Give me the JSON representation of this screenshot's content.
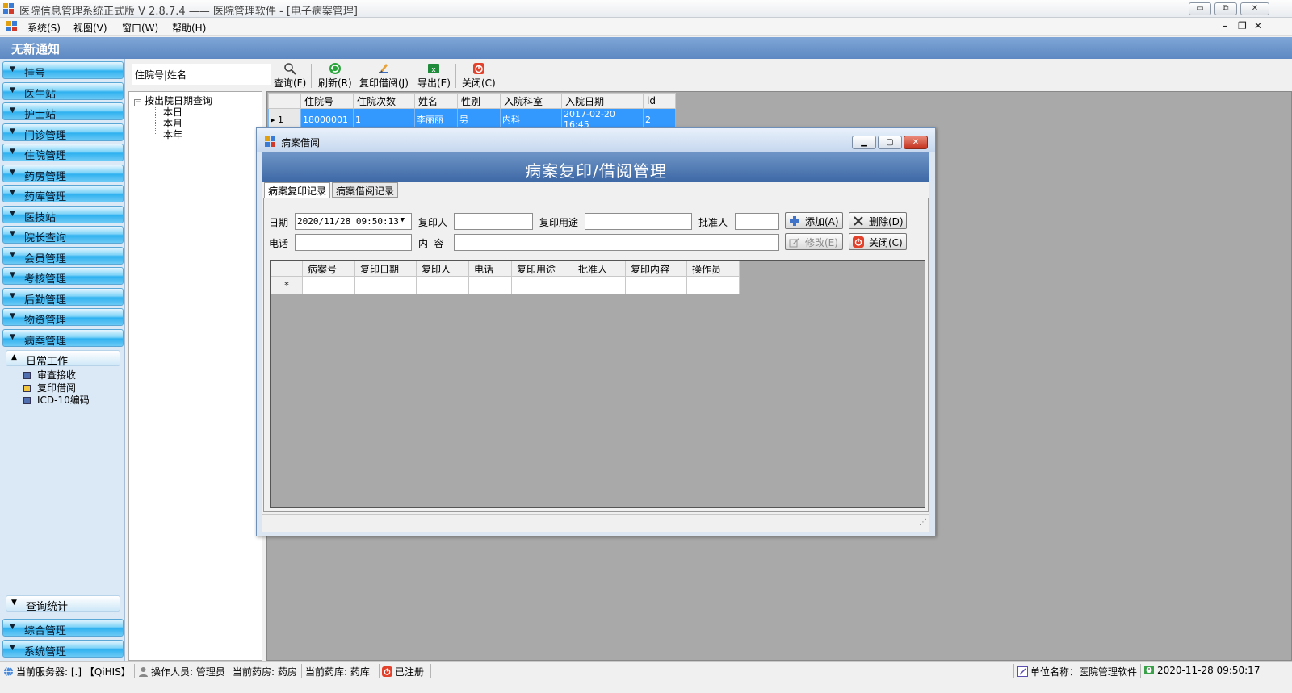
{
  "window": {
    "title": "医院信息管理系统正式版 V 2.8.7.4 —— 医院管理软件 - [电子病案管理]",
    "min": "▭",
    "restore": "⧉",
    "close": "✕"
  },
  "menu": {
    "items": [
      "系统(S)",
      "视图(V)",
      "窗口(W)",
      "帮助(H)"
    ],
    "mdi_controls": [
      "–",
      "❐",
      "✕"
    ]
  },
  "notice": "无新通知",
  "sidebar": {
    "items": [
      "挂号",
      "医生站",
      "护士站",
      "门诊管理",
      "住院管理",
      "药房管理",
      "药库管理",
      "医技站",
      "院长查询",
      "会员管理",
      "考核管理",
      "后勤管理",
      "物资管理",
      "病案管理"
    ],
    "bottom_items": [
      "综合管理",
      "系统管理"
    ],
    "groups": {
      "daily": "日常工作",
      "query": "查询统计"
    },
    "daily_items": [
      "审查接收",
      "复印借阅",
      "ICD-10编码"
    ]
  },
  "toolbar": {
    "search_value": "住院号|姓名",
    "buttons": [
      "查询(F)",
      "刷新(R)",
      "复印借阅(J)",
      "导出(E)",
      "关闭(C)"
    ]
  },
  "date_tree": {
    "root": "按出院日期查询",
    "children": [
      "本日",
      "本月",
      "本年"
    ]
  },
  "patient_grid": {
    "headers": [
      "住院号",
      "住院次数",
      "姓名",
      "性别",
      "入院科室",
      "入院日期",
      "id"
    ],
    "rows": [
      {
        "rownum": "1",
        "cells": [
          "18000001",
          "1",
          "李丽丽",
          "男",
          "内科",
          "2017-02-20 16:45",
          "2"
        ]
      }
    ]
  },
  "dialog": {
    "title": "病案借阅",
    "banner": "病案复印/借阅管理",
    "tabs": [
      "病案复印记录",
      "病案借阅记录"
    ],
    "form": {
      "date_label": "日期",
      "date_value": "2020/11/28 09:50:13",
      "copier_label": "复印人",
      "purpose_label": "复印用途",
      "approver_label": "批准人",
      "phone_label": "电话",
      "content_label": "内  容"
    },
    "buttons": {
      "add": "添加(A)",
      "delete": "删除(D)",
      "edit": "修改(E)",
      "close": "关闭(C)"
    },
    "grid": {
      "headers": [
        "病案号",
        "复印日期",
        "复印人",
        "电话",
        "复印用途",
        "批准人",
        "复印内容",
        "操作员"
      ],
      "new_row_marker": "*"
    }
  },
  "statusbar": {
    "server": "当前服务器: [.] 【QiHIS】",
    "operator": "操作人员: 管理员",
    "pharmacy": "当前药房: 药房",
    "warehouse": "当前药库: 药库",
    "registered": "已注册",
    "unit": "单位名称：医院管理软件",
    "datetime": "2020-11-28 09:50:17"
  },
  "colors": {
    "accent": "#3399ff",
    "banner": "#5d88c2",
    "nav": "#2fb1ef"
  }
}
